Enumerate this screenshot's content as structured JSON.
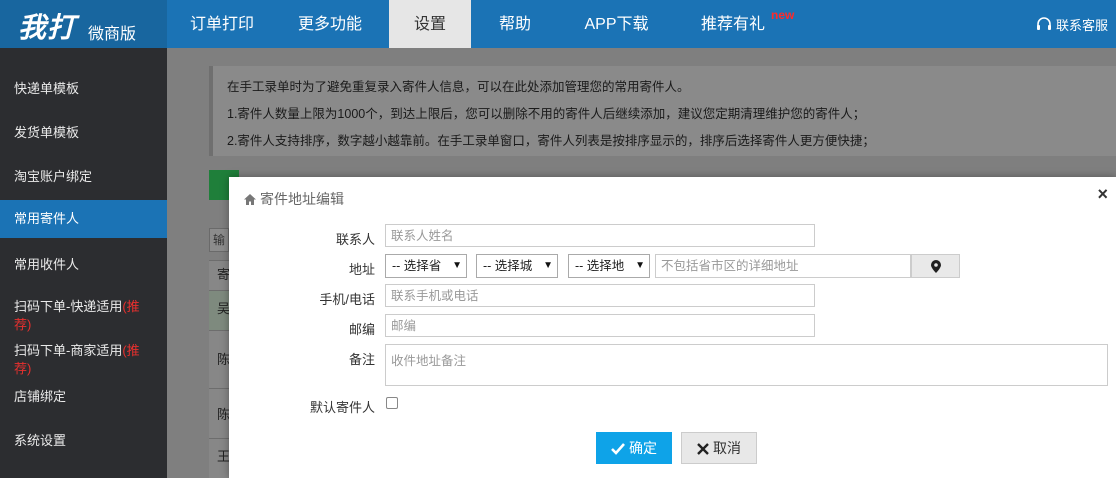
{
  "brand": {
    "logo_main": "我打",
    "logo_sub": "微商版"
  },
  "nav": {
    "items": [
      {
        "label": "订单打印"
      },
      {
        "label": "更多功能"
      },
      {
        "label": "设置"
      },
      {
        "label": "帮助"
      },
      {
        "label": "APP下载"
      },
      {
        "label": "推荐有礼"
      }
    ],
    "new_badge": "new",
    "customer_service": "联系客服",
    "active": "设置"
  },
  "sidebar": {
    "items": [
      {
        "label": "快递单模板"
      },
      {
        "label": "发货单模板"
      },
      {
        "label": "淘宝账户绑定"
      },
      {
        "label": "常用寄件人"
      },
      {
        "label": "常用收件人"
      },
      {
        "label": "扫码下单-快递适用",
        "tag_a": "(推",
        "tag_b": "荐)"
      },
      {
        "label": "扫码下单-商家适用",
        "tag_a": "(推",
        "tag_b": "荐)"
      },
      {
        "label": "店铺绑定"
      },
      {
        "label": "系统设置"
      }
    ],
    "active": "常用寄件人"
  },
  "notice": {
    "lines": [
      "在手工录单时为了避免重复录入寄件人信息，可以在此处添加管理您的常用寄件人。",
      "1.寄件人数量上限为1000个，到达上限后，您可以删除不用的寄件人后继续添加，建议您定期清理维护您的寄件人；",
      "2.寄件人支持排序，数字越小越靠前。在手工录单窗口，寄件人列表是按排序显示的，排序后选择寄件人更方便快捷；"
    ]
  },
  "background_table": {
    "search_partial": "输",
    "header_partial": "寄",
    "rows_partial": [
      "吴",
      "陈",
      "陈",
      "王"
    ]
  },
  "modal": {
    "title": "寄件地址编辑",
    "close": "×",
    "fields": {
      "contact_label": "联系人",
      "contact_placeholder": "联系人姓名",
      "address_label": "地址",
      "province_select": "-- 选择省",
      "city_select": "-- 选择城",
      "district_select": "-- 选择地",
      "detail_placeholder": "不包括省市区的详细地址",
      "phone_label": "手机/电话",
      "phone_placeholder": "联系手机或电话",
      "zip_label": "邮编",
      "zip_placeholder": "邮编",
      "remark_label": "备注",
      "remark_placeholder": "收件地址备注",
      "default_label": "默认寄件人",
      "default_checked": false
    },
    "ok_label": "确定",
    "cancel_label": "取消"
  },
  "colors": {
    "nav_bg": "#1b73b5",
    "sidebar_bg": "#2c2d30",
    "active_side": "#1b73b5",
    "ok_button": "#0ea3e8",
    "new_badge": "#ff2a2a",
    "hot_tag": "#e8302e"
  }
}
